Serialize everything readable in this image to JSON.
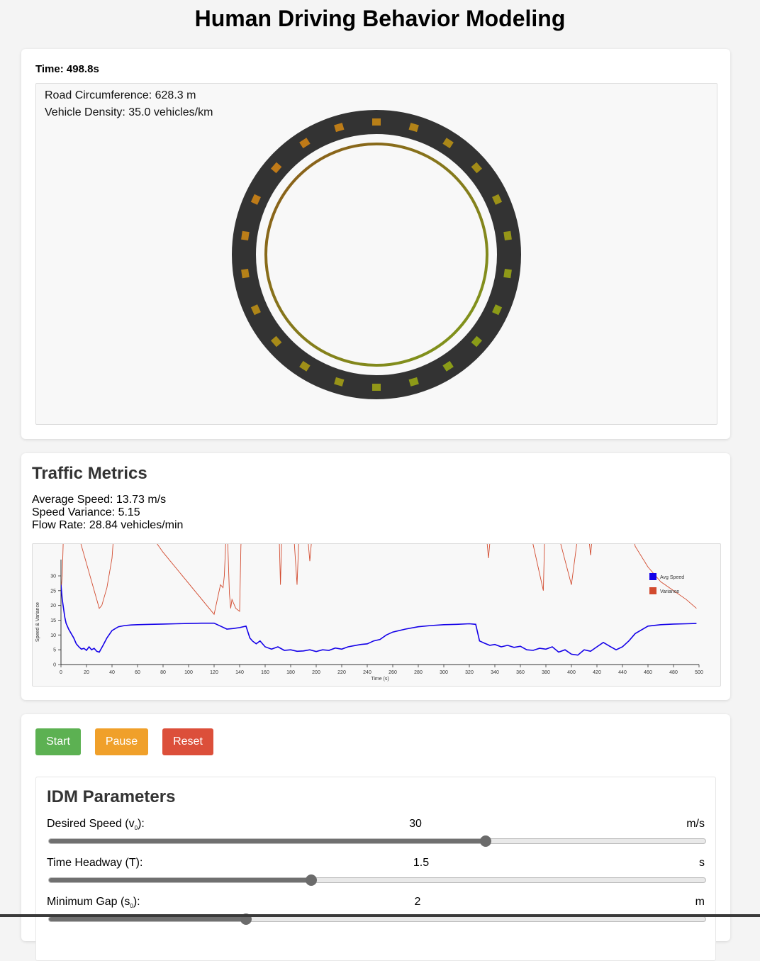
{
  "page": {
    "title": "Human Driving Behavior Modeling"
  },
  "simulation": {
    "time_label": "Time: 498.8s",
    "road_circumference": "Road Circumference: 628.3 m",
    "vehicle_density": "Vehicle Density: 35.0 vehicles/km",
    "vehicle_count": 22,
    "colors": {
      "road": "#333333",
      "vehicle_slow": "#c07a18",
      "vehicle_fast": "#8a9c18",
      "ring_start": "#8b5a1a",
      "ring_end": "#7f9a1c"
    }
  },
  "metrics": {
    "heading": "Traffic Metrics",
    "average_speed": "Average Speed: 13.73 m/s",
    "speed_variance": "Speed Variance: 5.15",
    "flow_rate": "Flow Rate: 28.84 vehicles/min"
  },
  "chart_data": {
    "type": "line",
    "xlabel": "Time (s)",
    "ylabel": "Speed & Variance",
    "xlim": [
      0,
      500
    ],
    "ylim": [
      0,
      30
    ],
    "x_ticks": [
      0,
      20,
      40,
      60,
      80,
      100,
      120,
      140,
      160,
      180,
      200,
      220,
      240,
      260,
      280,
      300,
      320,
      340,
      360,
      380,
      400,
      420,
      440,
      460,
      480,
      500
    ],
    "y_ticks": [
      0,
      5,
      10,
      15,
      20,
      25,
      30
    ],
    "legend_position": "top-right",
    "series": [
      {
        "name": "Avg Speed",
        "color": "#1400e8",
        "x": [
          0,
          1,
          2,
          3,
          4,
          6,
          8,
          10,
          12,
          14,
          16,
          18,
          20,
          22,
          24,
          26,
          28,
          30,
          33,
          36,
          40,
          45,
          50,
          55,
          60,
          70,
          80,
          90,
          100,
          110,
          120,
          125,
          130,
          135,
          140,
          145,
          148,
          150,
          153,
          156,
          160,
          165,
          170,
          175,
          180,
          185,
          190,
          195,
          200,
          205,
          210,
          215,
          220,
          225,
          230,
          235,
          240,
          245,
          250,
          255,
          260,
          270,
          280,
          290,
          300,
          310,
          320,
          325,
          328,
          332,
          336,
          340,
          345,
          350,
          355,
          360,
          365,
          370,
          375,
          380,
          385,
          390,
          395,
          400,
          405,
          410,
          415,
          420,
          425,
          430,
          435,
          440,
          445,
          450,
          460,
          470,
          480,
          490,
          498
        ],
        "values": [
          27,
          22,
          19,
          16,
          14,
          12,
          10.5,
          9,
          7,
          6,
          5.2,
          5.5,
          4.8,
          6,
          5,
          5.5,
          4.5,
          4.2,
          6.5,
          9,
          11.5,
          12.8,
          13.2,
          13.4,
          13.5,
          13.6,
          13.7,
          13.8,
          13.9,
          14,
          14,
          13,
          12,
          12.2,
          12.5,
          13,
          9,
          8,
          7,
          8,
          6,
          5.2,
          6,
          4.8,
          5,
          4.5,
          4.6,
          5,
          4.4,
          5,
          4.8,
          5.6,
          5.2,
          6,
          6.4,
          6.8,
          7,
          8,
          8.5,
          10,
          11,
          12,
          12.8,
          13.2,
          13.5,
          13.6,
          13.8,
          13.6,
          8,
          7.2,
          6.5,
          6.8,
          6,
          6.5,
          5.8,
          6.2,
          5,
          4.8,
          5.5,
          5.2,
          6,
          4.2,
          5,
          3.5,
          3.2,
          5,
          4.5,
          6,
          7.5,
          6.2,
          5,
          6,
          8,
          10.5,
          13,
          13.5,
          13.7,
          13.8,
          13.9
        ]
      },
      {
        "name": "Variance",
        "color": "#d24a2e",
        "x": [
          0,
          1,
          2,
          3,
          30,
          32,
          36,
          40,
          44,
          80,
          120,
          125,
          127,
          128,
          130,
          132,
          133,
          134,
          137,
          140,
          141,
          143,
          170,
          172,
          174,
          180,
          185,
          188,
          190,
          195,
          200,
          220,
          240,
          260,
          270,
          300,
          310,
          320,
          330,
          335,
          340,
          345,
          350,
          355,
          360,
          378,
          380,
          400,
          410,
          415,
          420,
          435,
          440,
          450,
          460,
          470,
          480,
          490,
          498
        ],
        "values": [
          25,
          30,
          45,
          60,
          19,
          20,
          26,
          36,
          60,
          38,
          17,
          27,
          26,
          30,
          50,
          24,
          19,
          22,
          19,
          18,
          40,
          60,
          60,
          27,
          60,
          60,
          27,
          60,
          60,
          35,
          60,
          60,
          60,
          60,
          60,
          60,
          60,
          60,
          60,
          36,
          60,
          60,
          60,
          60,
          60,
          25,
          60,
          27,
          60,
          37,
          60,
          60,
          60,
          40,
          33,
          28,
          25,
          22,
          19
        ]
      }
    ]
  },
  "controls": {
    "start_label": "Start",
    "pause_label": "Pause",
    "reset_label": "Reset",
    "colors": {
      "start": "#5cb152",
      "pause": "#f0a02a",
      "reset": "#dc4f3a"
    }
  },
  "parameters": {
    "heading": "IDM Parameters",
    "items": [
      {
        "label_main": "Desired Speed (v",
        "label_sub": "0",
        "label_end": "):",
        "value": "30",
        "unit": "m/s",
        "fraction": 0.665
      },
      {
        "label_main": "Time Headway (T):",
        "label_sub": "",
        "label_end": "",
        "value": "1.5",
        "unit": "s",
        "fraction": 0.4
      },
      {
        "label_main": "Minimum Gap (s",
        "label_sub": "0",
        "label_end": "):",
        "value": "2",
        "unit": "m",
        "fraction": 0.3
      }
    ]
  }
}
